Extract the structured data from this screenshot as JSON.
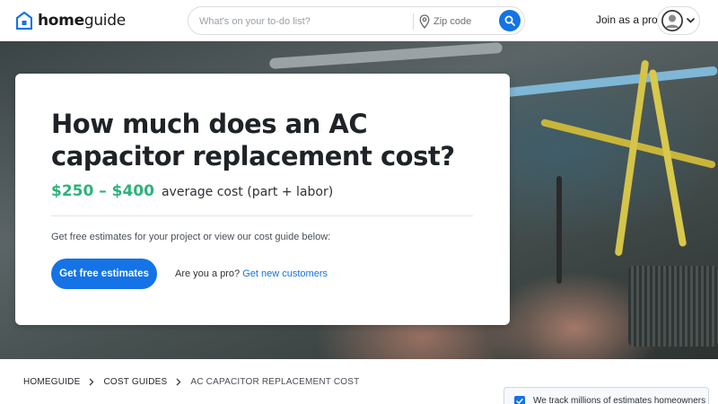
{
  "header": {
    "logo_bold": "home",
    "logo_light": "guide",
    "search_placeholder": "What's on your to-do list?",
    "zip_placeholder": "Zip code",
    "join_label": "Join as a pro"
  },
  "hero": {
    "title": "How much does an AC capacitor replacement cost?",
    "price": "$250 – $400",
    "price_note": "average cost (part + labor)",
    "subtitle": "Get free estimates for your project or view our cost guide below:",
    "cta_label": "Get free estimates",
    "pro_question": "Are you a pro?",
    "pro_link": "Get new customers"
  },
  "breadcrumb": {
    "items": [
      "HOMEGUIDE",
      "COST GUIDES",
      "AC CAPACITOR REPLACEMENT COST"
    ]
  },
  "info_box": {
    "text": "We track millions of estimates homeowners"
  },
  "colors": {
    "brand_blue": "#1473e6",
    "price_green": "#2db37a"
  },
  "icons": [
    "home-logo-icon",
    "map-pin-icon",
    "search-icon",
    "user-icon",
    "chevron-down-icon",
    "chevron-right-icon",
    "checkmark-icon"
  ]
}
